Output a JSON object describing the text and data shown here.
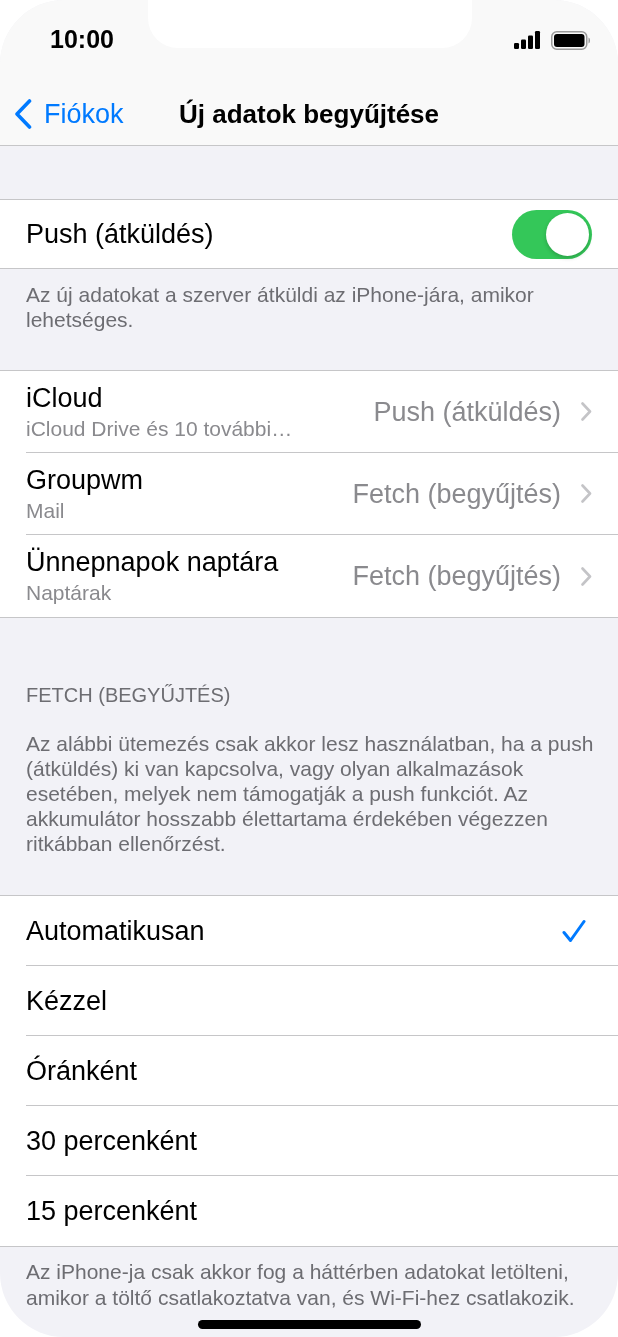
{
  "status_bar": {
    "time": "10:00"
  },
  "nav_bar": {
    "back_label": "Fiókok",
    "title": "Új adatok begyűjtése"
  },
  "push": {
    "label": "Push (átküldés)",
    "on": true,
    "footer": "Az új adatokat a szerver átküldi az iPhone-jára, amikor lehetséges."
  },
  "accounts": [
    {
      "name": "iCloud",
      "detail": "iCloud Drive és 10 további…",
      "value": "Push (átküldés)"
    },
    {
      "name": "Groupwm",
      "detail": "Mail",
      "value": "Fetch (begyűjtés)"
    },
    {
      "name": "Ünnepnapok naptára",
      "detail": "Naptárak",
      "value": "Fetch (begyűjtés)"
    }
  ],
  "fetch": {
    "header": "FETCH (BEGYŰJTÉS)",
    "description": "Az alábbi ütemezés csak akkor lesz használatban, ha a push (átküldés) ki van kapcsolva, vagy olyan alkalmazások esetében, melyek nem támogatják a push funkciót. Az akkumulátor hosszabb élettartama érdekében végezzen ritkábban ellenőrzést.",
    "options": [
      {
        "label": "Automatikusan",
        "selected": true
      },
      {
        "label": "Kézzel",
        "selected": false
      },
      {
        "label": "Óránként",
        "selected": false
      },
      {
        "label": "30 percenként",
        "selected": false
      },
      {
        "label": "15 percenként",
        "selected": false
      }
    ],
    "footer": "Az iPhone-ja csak akkor fog a háttérben adatokat letölteni, amikor a töltő csatlakoztatva van, és Wi-Fi-hez csatlakozik."
  }
}
